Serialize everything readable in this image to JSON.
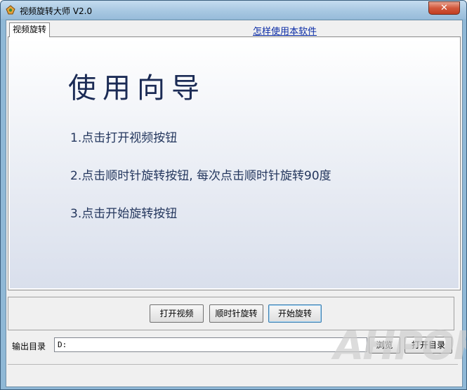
{
  "window": {
    "title": "视频旋转大师 V2.0",
    "close_symbol": "✕",
    "icon": "app-icon"
  },
  "tabs": [
    {
      "label": "视频旋转",
      "active": true
    }
  ],
  "help_link": "怎样使用本软件",
  "guide": {
    "title": "使用向导",
    "steps": [
      "1.点击打开视频按钮",
      "2.点击顺时针旋转按钮, 每次点击顺时针旋转90度",
      "3.点击开始旋转按钮"
    ]
  },
  "buttons": {
    "open_video": "打开视频",
    "rotate_clockwise": "顺时针旋转",
    "start_rotate": "开始旋转"
  },
  "output": {
    "label": "输出目录",
    "value": "D:",
    "browse": "浏览",
    "open_dir": "打开目录"
  },
  "watermark": "AHPOK",
  "colors": {
    "title_text": "#1b2b55",
    "link": "#0b2ca6",
    "close_button": "#c23e22"
  }
}
